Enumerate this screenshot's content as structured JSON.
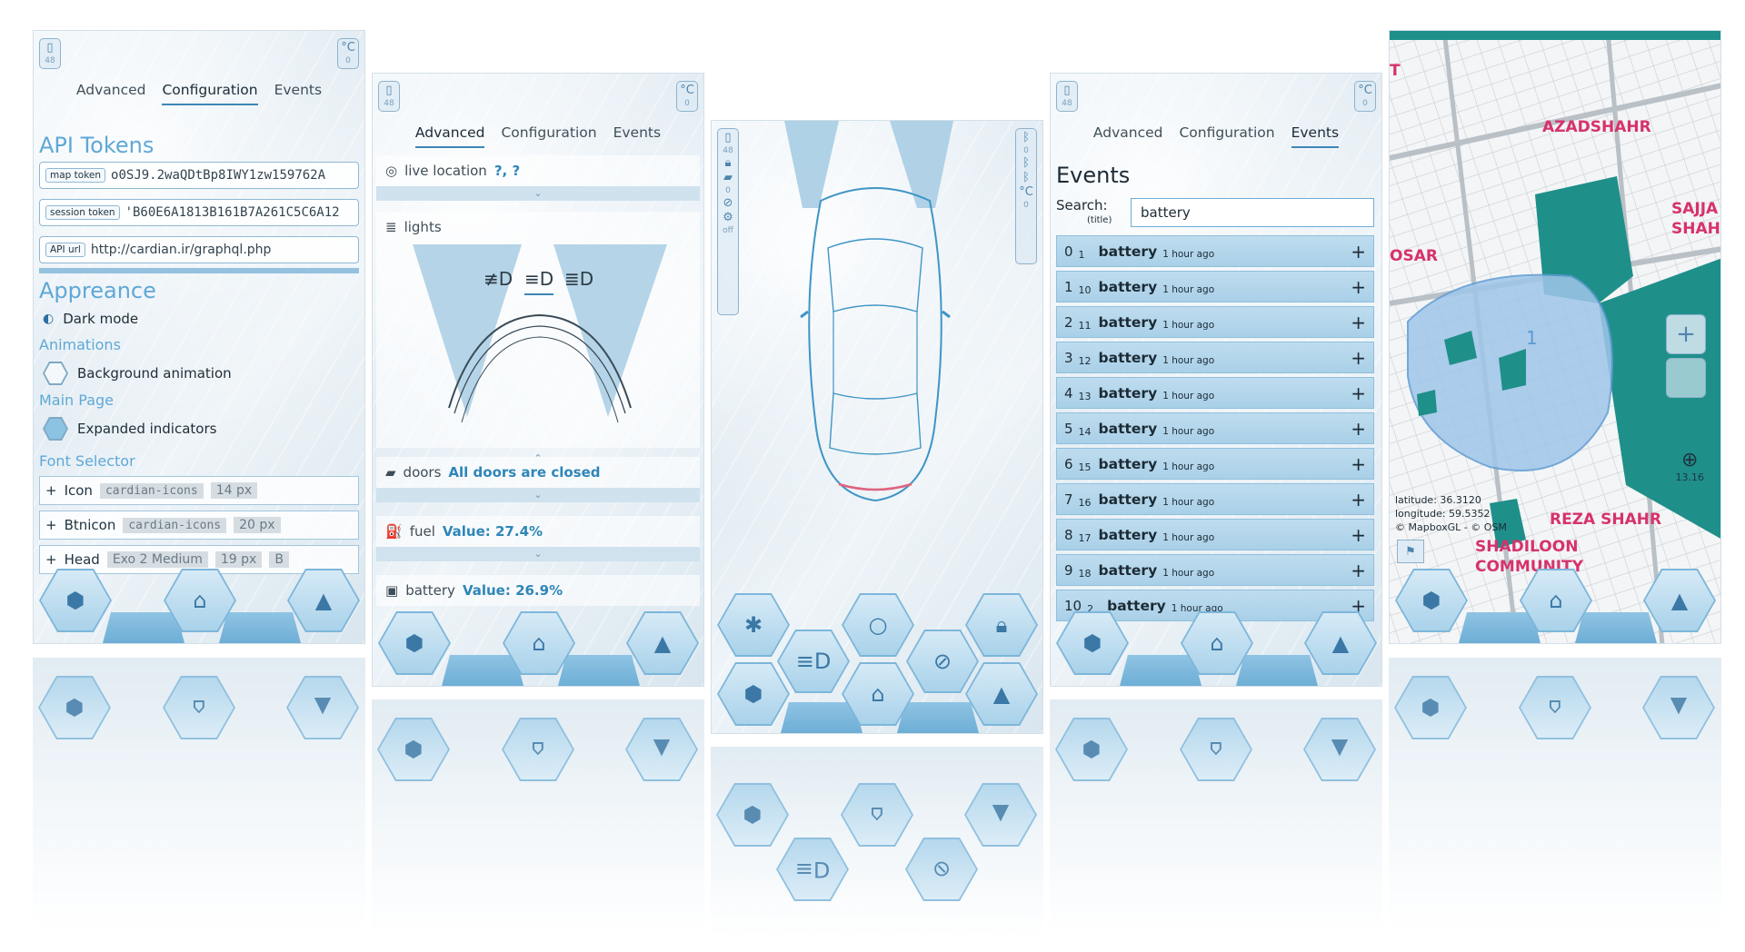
{
  "config": {
    "pill_left": {
      "icon": "🔋",
      "value": "48"
    },
    "pill_right": {
      "icon": "°C",
      "value": "0"
    },
    "tabs": [
      "Advanced",
      "Configuration",
      "Events"
    ],
    "api_tokens_title": "API Tokens",
    "tokens": [
      {
        "label": "map token",
        "value": "o0SJ9.2waQDtBp8IWY1zw159762A"
      },
      {
        "label": "session token",
        "value": "'B60E6A1813B161B7A261C5C6A12"
      },
      {
        "label": "API url",
        "value": "http://cardian.ir/graphql.php"
      }
    ],
    "appearance_title": "Appreance",
    "dark_mode": "Dark mode",
    "animations_title": "Animations",
    "background_animation": "Background animation",
    "main_page_title": "Main Page",
    "expanded_indicators": "Expanded indicators",
    "font_selector_title": "Font Selector",
    "fonts": [
      {
        "name": "Icon",
        "family": "cardian-icons",
        "size": "14 px",
        "weight": ""
      },
      {
        "name": "Btnicon",
        "family": "cardian-icons",
        "size": "20 px",
        "weight": ""
      },
      {
        "name": "Head",
        "family": "Exo 2 Medium",
        "size": "19 px",
        "weight": "B"
      }
    ]
  },
  "advanced": {
    "pill_left": {
      "icon": "🔋",
      "value": "48"
    },
    "pill_right": {
      "icon": "°C",
      "value": "0"
    },
    "tabs": [
      "Advanced",
      "Configuration",
      "Events"
    ],
    "live_location_label": "live location",
    "live_location_value": "?, ?",
    "lights_label": "lights",
    "doors_label": "doors",
    "doors_value": "All doors are closed",
    "fuel_label": "fuel",
    "fuel_value": "Value: 27.4%",
    "battery_label": "battery",
    "battery_value": "Value: 26.9%"
  },
  "car": {
    "pill_left_values": [
      "48",
      "0",
      "off"
    ],
    "pill_right_values": [
      "0",
      "0"
    ]
  },
  "events": {
    "pill_left": {
      "icon": "🔋",
      "value": "48"
    },
    "pill_right": {
      "icon": "°C",
      "value": "0"
    },
    "tabs": [
      "Advanced",
      "Configuration",
      "Events"
    ],
    "title": "Events",
    "search_label": "Search:",
    "search_sub": "(title)",
    "search_value": "battery",
    "rows": [
      {
        "idx": "0",
        "sub": "1",
        "name": "battery",
        "time": "1 hour ago"
      },
      {
        "idx": "1",
        "sub": "10",
        "name": "battery",
        "time": "1 hour ago"
      },
      {
        "idx": "2",
        "sub": "11",
        "name": "battery",
        "time": "1 hour ago"
      },
      {
        "idx": "3",
        "sub": "12",
        "name": "battery",
        "time": "1 hour ago"
      },
      {
        "idx": "4",
        "sub": "13",
        "name": "battery",
        "time": "1 hour ago"
      },
      {
        "idx": "5",
        "sub": "14",
        "name": "battery",
        "time": "1 hour ago"
      },
      {
        "idx": "6",
        "sub": "15",
        "name": "battery",
        "time": "1 hour ago"
      },
      {
        "idx": "7",
        "sub": "16",
        "name": "battery",
        "time": "1 hour ago"
      },
      {
        "idx": "8",
        "sub": "17",
        "name": "battery",
        "time": "1 hour ago"
      },
      {
        "idx": "9",
        "sub": "18",
        "name": "battery",
        "time": "1 hour ago"
      },
      {
        "idx": "10",
        "sub": "2",
        "name": "battery",
        "time": "1 hour ago"
      }
    ]
  },
  "map": {
    "labels": [
      "AZADSHAHR",
      "SAJJA",
      "SHAHI",
      "OSAR",
      "REZA SHAHR",
      "SHADILOON",
      "COMMUNITY",
      "T"
    ],
    "latitude": "latitude: 36.3120",
    "longitude": "longitude: 59.5352",
    "attribution": "© MapboxGL - © OSM",
    "compass_value": "13.16",
    "area_number": "1"
  },
  "colors": {
    "accent": "#5fa8d6",
    "hex": "#7db6da",
    "map_green": "#1f8f8a",
    "map_label": "#d6326c"
  }
}
